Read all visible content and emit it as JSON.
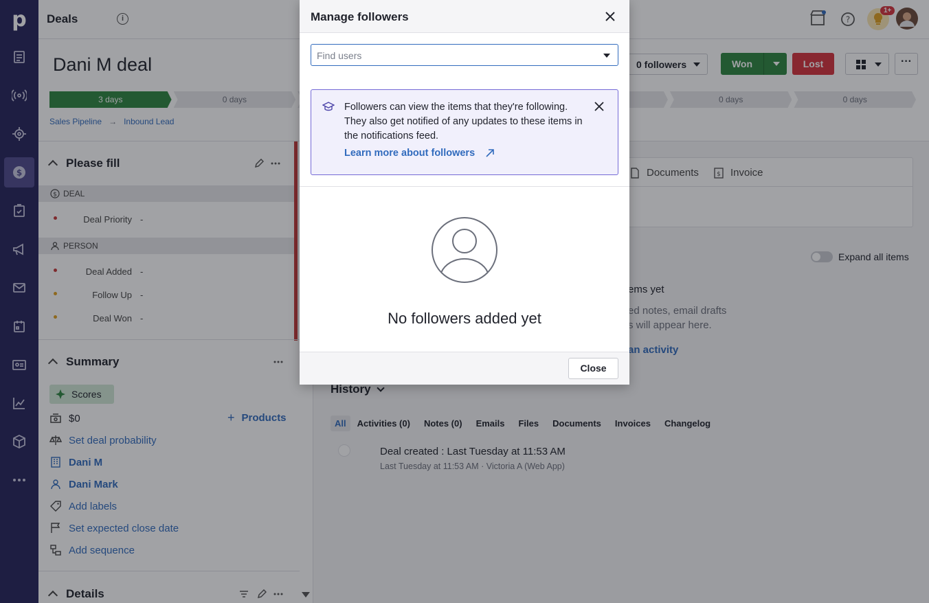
{
  "app": {
    "logo_letter": "p",
    "page_title": "Deals",
    "info_glyph": "i"
  },
  "topbar": {
    "notification_badge": "1+"
  },
  "deal": {
    "title": "Dani M deal",
    "stages": [
      "3 days",
      "0 days",
      "",
      "",
      "",
      "0 days",
      "0 days"
    ],
    "completed_stages": 1,
    "breadcrumb": [
      "Sales Pipeline",
      "Inbound Lead"
    ],
    "followers_label": "0 followers",
    "won_label": "Won",
    "lost_label": "Lost",
    "more_label": "···"
  },
  "sidebar": {
    "please_fill": {
      "title": "Please fill",
      "deal_group": "DEAL",
      "person_group": "PERSON",
      "deal_fields": [
        {
          "label": "Deal Priority",
          "value": "-",
          "dot": "#c53a3a"
        }
      ],
      "person_fields": [
        {
          "label": "Deal Added",
          "value": "-",
          "dot": "#c53a3a"
        },
        {
          "label": "Follow Up",
          "value": "-",
          "dot": "#e0a020"
        },
        {
          "label": "Deal Won",
          "value": "-",
          "dot": "#e0a020"
        }
      ]
    },
    "summary": {
      "title": "Summary",
      "scores": "Scores",
      "amount": "$0",
      "products": "Products",
      "probability": "Set deal probability",
      "organization": "Dani M",
      "person": "Dani Mark",
      "labels": "Add labels",
      "close_date": "Set expected close date",
      "sequence": "Add sequence"
    },
    "details": {
      "title": "Details"
    }
  },
  "main": {
    "tabs": [
      "Documents",
      "Invoice"
    ],
    "expand_all": "Expand all items",
    "empty_partial_1": "ems yet",
    "empty_partial_2": "ed notes, email drafts",
    "empty_partial_3": "s will appear here.",
    "empty_partial_link": "an activity",
    "history_title": "History",
    "history_tabs": [
      "All",
      "Activities (0)",
      "Notes (0)",
      "Emails",
      "Files",
      "Documents",
      "Invoices",
      "Changelog"
    ],
    "history_item": "Deal created : Last Tuesday at 11:53 AM",
    "history_meta": "Last Tuesday at 11:53 AM · Victoria A (Web App)"
  },
  "modal": {
    "title": "Manage followers",
    "search_placeholder": "Find users",
    "info_text": "Followers can view the items that they're following. They also get notified of any updates to these items in the notifications feed.",
    "learn_more": "Learn more about followers",
    "empty_text": "No followers added yet",
    "close_label": "Close"
  },
  "colors": {
    "nav_bg": "#26235b",
    "won": "#2e8540",
    "lost": "#d6333c",
    "link": "#316bbd",
    "info_border": "#7369d6"
  }
}
